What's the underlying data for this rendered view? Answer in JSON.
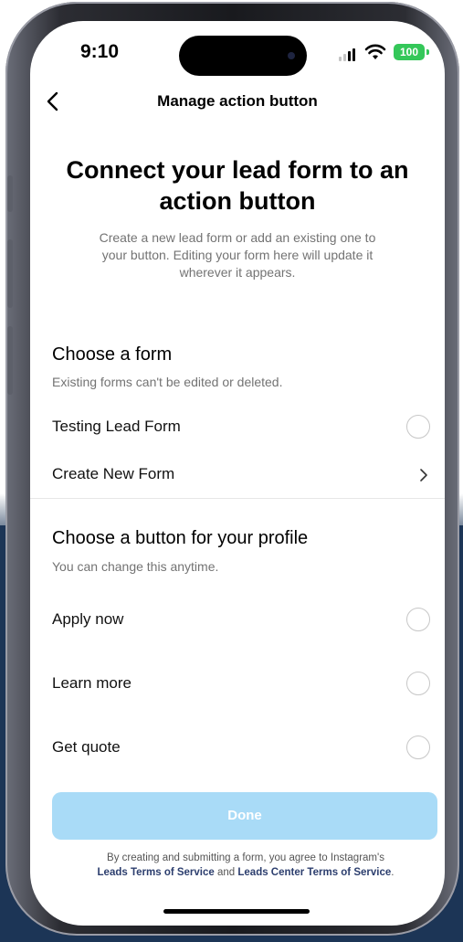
{
  "status_bar": {
    "time": "9:10",
    "battery": "100"
  },
  "nav": {
    "title": "Manage action button"
  },
  "hero": {
    "title_line1": "Connect your lead form to an",
    "title_line2": "action button",
    "desc_line1": "Create a new lead form or add an existing one to",
    "desc_line2": "your button. Editing your form here will update it",
    "desc_line3": "wherever it appears."
  },
  "form_section": {
    "title": "Choose a form",
    "subtitle": "Existing forms can't be edited or deleted.",
    "items": [
      {
        "label": "Testing Lead Form",
        "control": "radio",
        "selected": false
      },
      {
        "label": "Create New Form",
        "control": "chevron"
      }
    ]
  },
  "button_section": {
    "title": "Choose a button for your profile",
    "subtitle": "You can change this anytime.",
    "items": [
      {
        "label": "Apply now",
        "selected": false
      },
      {
        "label": "Learn more",
        "selected": false
      },
      {
        "label": "Get quote",
        "selected": false
      }
    ]
  },
  "done_button": {
    "label": "Done",
    "enabled": false
  },
  "terms": {
    "prefix": "By creating and submitting a form, you agree to Instagram's",
    "link1": "Leads Terms of Service",
    "middle": " and ",
    "link2": "Leads Center Terms of Service",
    "suffix": "."
  },
  "colors": {
    "accent_disabled": "#a9dbf7",
    "link": "#2c3e6e",
    "battery": "#34c759",
    "backdrop": "#1c3556"
  }
}
